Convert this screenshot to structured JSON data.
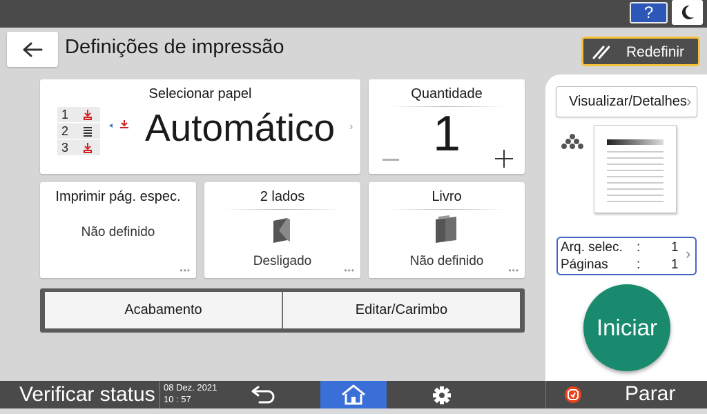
{
  "header": {
    "help_label": "?",
    "title": "Definições de impressão",
    "reset_label": "Redefinir"
  },
  "paper": {
    "title": "Selecionar papel",
    "value": "Automático",
    "trays": [
      "1",
      "2",
      "3"
    ]
  },
  "quantity": {
    "title": "Quantidade",
    "value": "1"
  },
  "tiles": {
    "print_pages": {
      "title": "Imprimir pág. espec.",
      "value": "Não definido"
    },
    "two_sided": {
      "title": "2 lados",
      "value": "Desligado"
    },
    "book": {
      "title": "Livro",
      "value": "Não definido"
    }
  },
  "segments": {
    "finishing": "Acabamento",
    "edit_stamp": "Editar/Carimbo"
  },
  "preview": {
    "view_details_label": "Visualizar/Detalhes",
    "files_label": "Arq. selec.",
    "files_value": "1",
    "pages_label": "Páginas",
    "pages_value": "1",
    "separator": ":"
  },
  "start_label": "Iniciar",
  "bottom": {
    "check_status": "Verificar status",
    "date": "08 Dez. 2021",
    "time": "10 : 57",
    "stop_label": "Parar"
  },
  "colors": {
    "accent_blue": "#2c57b8",
    "home_blue": "#3a6fd8",
    "start_green": "#1a8a6e",
    "reset_border": "#f5c23a",
    "tray_red": "#d22222",
    "stop_orange": "#e8421b",
    "frame_blue": "#4468c9"
  },
  "icons": {
    "help": "help-icon",
    "theme": "moon-icon",
    "back": "arrow-left-icon",
    "reset": "reset-slashes-icon",
    "paper": "paper-trays-icon",
    "duplex": "two-sided-icon",
    "book": "book-icon",
    "color_mode": "color-dots-icon",
    "undo": "undo-arrow-icon",
    "home": "home-icon",
    "settings": "gear-icon",
    "stop": "stop-icon"
  }
}
